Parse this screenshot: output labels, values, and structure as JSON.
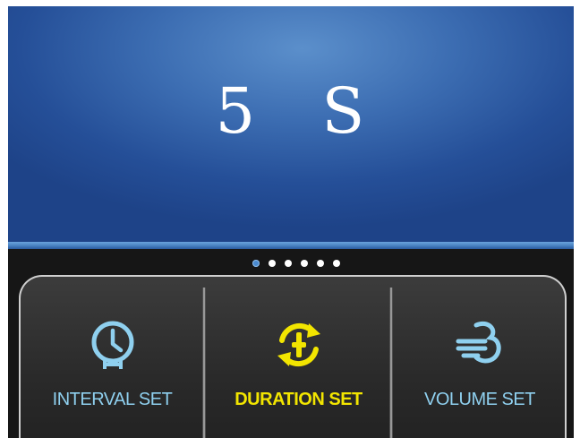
{
  "display": {
    "value": "5",
    "unit": "S"
  },
  "pager": {
    "count": 6,
    "active_index": 0
  },
  "buttons": [
    {
      "label": "INTERVAL SET",
      "icon": "clock-icon",
      "color": "#8fd0ef",
      "selected": false
    },
    {
      "label": "DURATION SET",
      "icon": "refresh-cycle-icon",
      "color": "#f2e500",
      "selected": true
    },
    {
      "label": "VOLUME SET",
      "icon": "wind-icon",
      "color": "#8fd0ef",
      "selected": false
    }
  ],
  "colors": {
    "display_bg": "#3c6db2",
    "accent_blue": "#8fd0ef",
    "accent_yellow": "#f2e500"
  }
}
